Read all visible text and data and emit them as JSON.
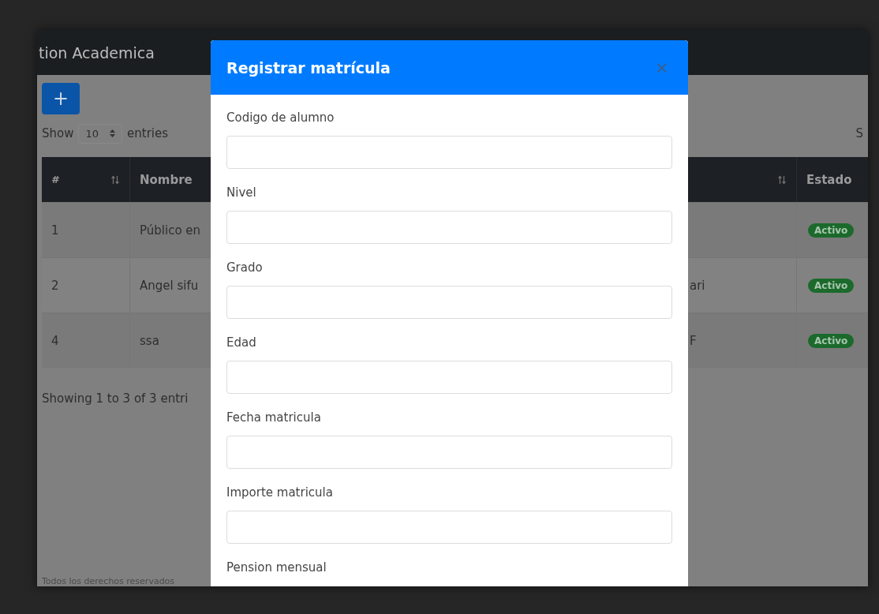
{
  "app": {
    "title": "tion Academica"
  },
  "toolbar": {
    "add_button": "+",
    "length_prefix": "Show",
    "length_value": "10",
    "length_suffix": "entries",
    "search_label": "S"
  },
  "table": {
    "columns": [
      {
        "label": "#",
        "sort_icon": true
      },
      {
        "label": "Nombre",
        "sort_icon": false
      },
      {
        "sort_icon": true
      },
      {
        "label": "Estado",
        "sort_icon": false
      }
    ],
    "rows": [
      {
        "number": "1",
        "nombre": "Público en",
        "estado": "Activo"
      },
      {
        "number": "2",
        "nombre": "Angel sifu",
        "column_3": "ari",
        "estado": "Activo"
      },
      {
        "number": "4",
        "nombre": "ssa",
        "column_3": "F",
        "estado": "Activo"
      }
    ]
  },
  "info": "Showing 1 to 3 of 3 entri",
  "footer": "Todos los derechos reservados",
  "modal": {
    "title": "Registrar matrícula",
    "close": "×",
    "fields": [
      {
        "label": "Codigo de alumno",
        "kind": "input"
      },
      {
        "label": "Nivel",
        "kind": "input"
      },
      {
        "label": "Grado",
        "kind": "input"
      },
      {
        "label": "Edad",
        "kind": "input"
      },
      {
        "label": "Fecha matricula",
        "kind": "input"
      },
      {
        "label": "Importe matricula",
        "kind": "input"
      },
      {
        "label": "Pension mensual",
        "kind": "label-only"
      }
    ]
  }
}
